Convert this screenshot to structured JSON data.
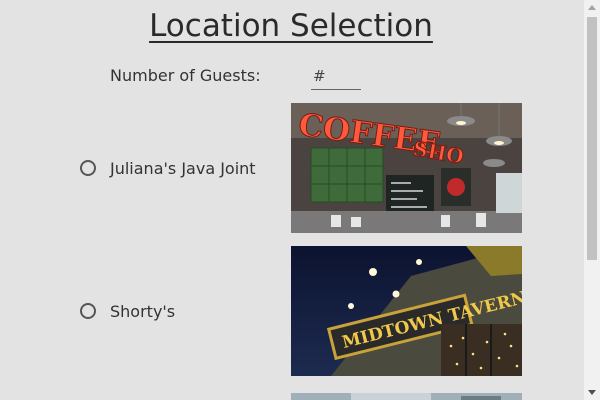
{
  "page": {
    "title": "Location Selection"
  },
  "guests": {
    "label": "Number of Guests:",
    "placeholder": "#",
    "value": ""
  },
  "locations": [
    {
      "name": "Juliana's Java Joint",
      "photo_sign_text": "COFFEE SHOP",
      "selected": false
    },
    {
      "name": "Shorty's",
      "photo_sign_text": "MIDTOWN TAVERN",
      "selected": false
    }
  ],
  "colors": {
    "background": "#e3e3e3",
    "text": "#333333",
    "scrollbar_track": "#f1f1f1",
    "scrollbar_thumb": "#c1c1c1"
  }
}
